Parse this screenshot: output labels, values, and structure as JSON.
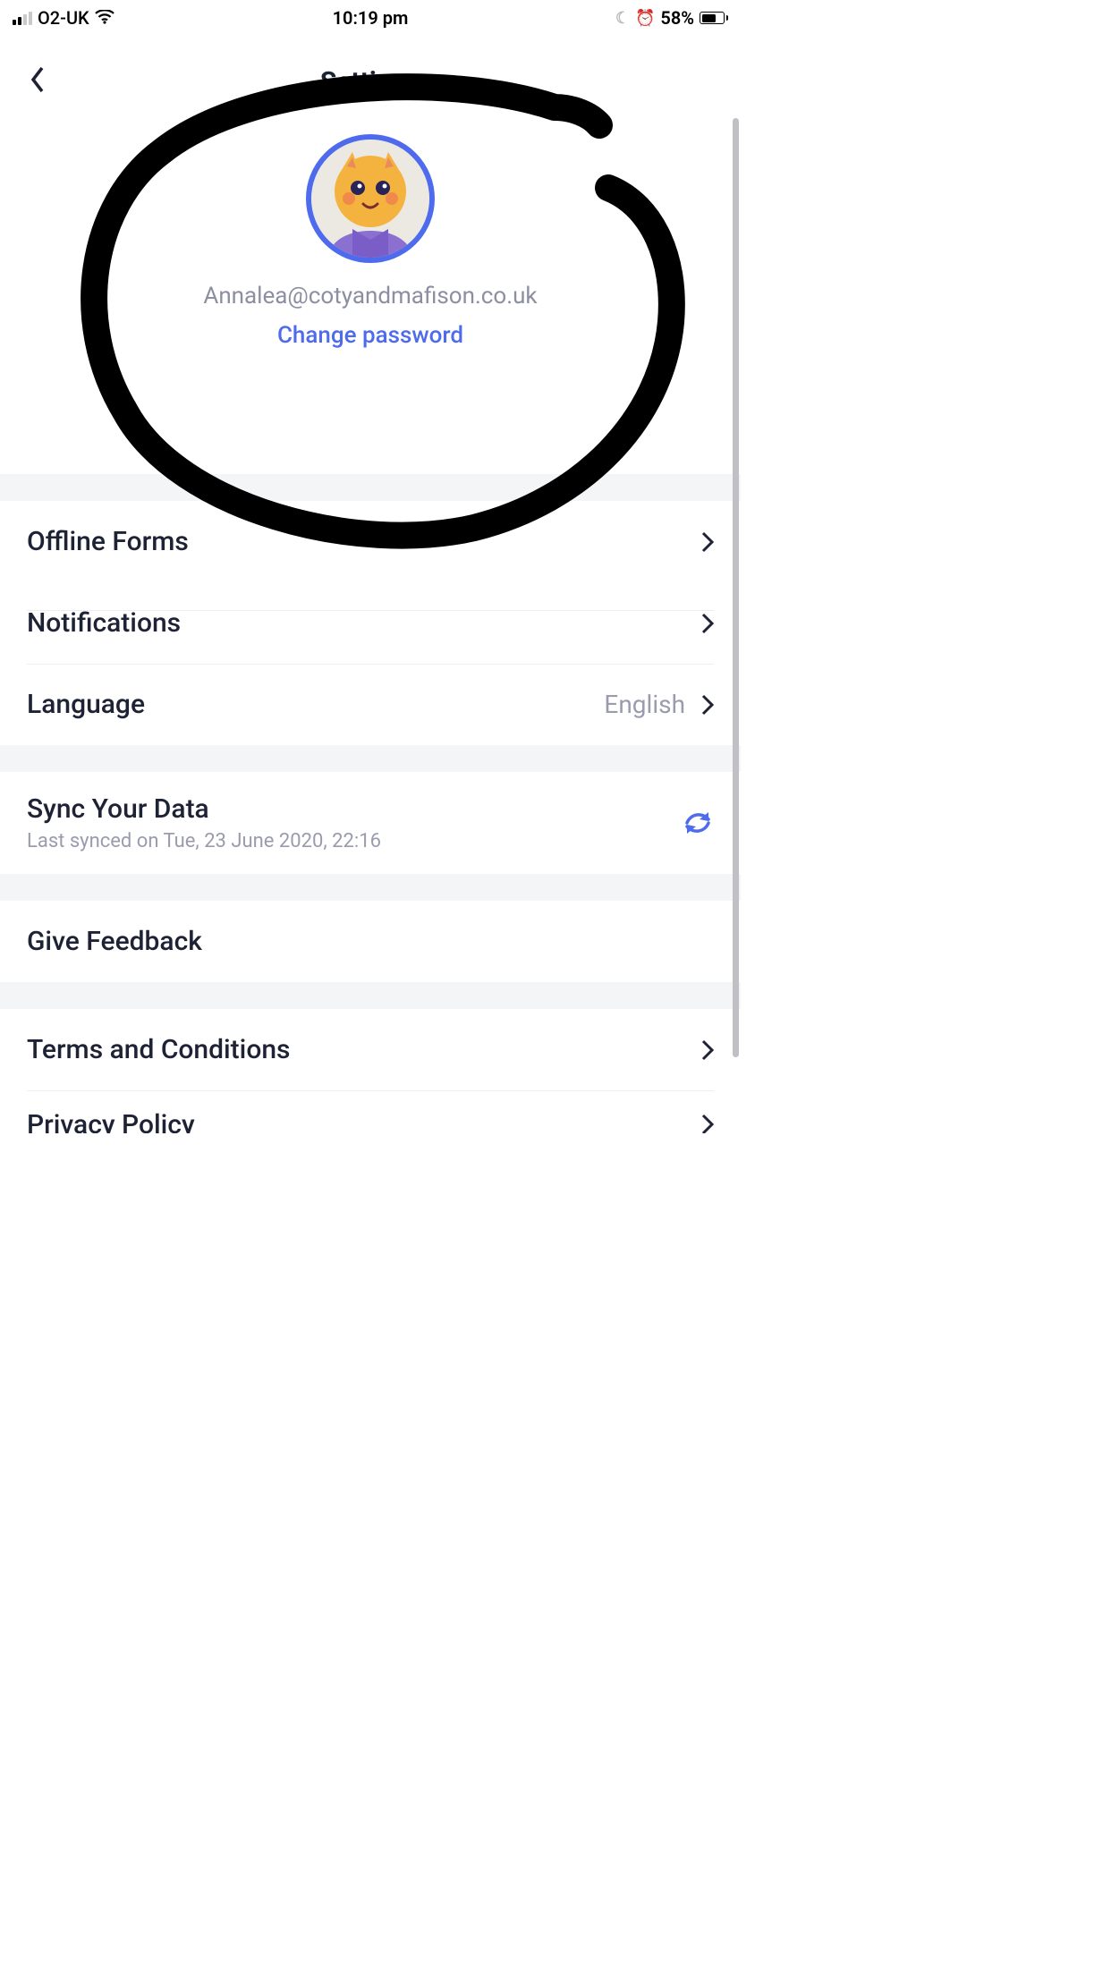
{
  "status_bar": {
    "carrier": "O2-UK",
    "time": "10:19 pm",
    "battery_percent": "58%"
  },
  "header": {
    "title": "Settings"
  },
  "profile": {
    "email": "Annalea@cotyandmafison.co.uk",
    "change_password_label": "Change password"
  },
  "groups": {
    "general": {
      "offline_forms": "Offline Forms",
      "notifications": "Notifications",
      "language_label": "Language",
      "language_value": "English"
    },
    "sync": {
      "title": "Sync Your Data",
      "subtitle": "Last synced on Tue, 23 June 2020, 22:16"
    },
    "feedback": {
      "give_feedback": "Give Feedback"
    },
    "legal": {
      "terms": "Terms and Conditions",
      "privacy": "Privacy Policy"
    }
  },
  "colors": {
    "accent": "#4f6bed",
    "text": "#1e2235",
    "muted": "#9a9cae",
    "separator": "#f4f5f7"
  }
}
